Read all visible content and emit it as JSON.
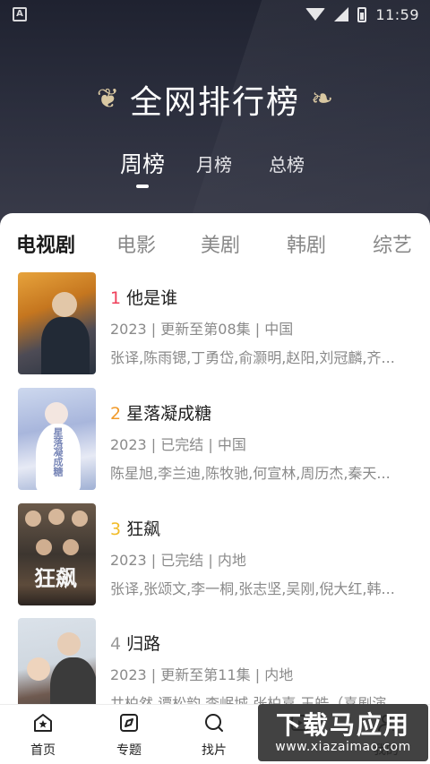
{
  "status_bar": {
    "time": "11:59"
  },
  "header": {
    "title": "全网排行榜",
    "rank_tabs": [
      {
        "label": "周榜",
        "active": true
      },
      {
        "label": "月榜",
        "active": false
      },
      {
        "label": "总榜",
        "active": false
      }
    ]
  },
  "categories": [
    {
      "label": "电视剧",
      "active": true
    },
    {
      "label": "电影",
      "active": false
    },
    {
      "label": "美剧",
      "active": false
    },
    {
      "label": "韩剧",
      "active": false
    },
    {
      "label": "综艺",
      "active": false
    }
  ],
  "items": [
    {
      "rank": "1",
      "title": "他是谁",
      "meta": "2023 | 更新至第08集 | 中国",
      "cast": "张译,陈雨锶,丁勇岱,俞灏明,赵阳,刘冠麟,齐..."
    },
    {
      "rank": "2",
      "title": "星落凝成糖",
      "meta": "2023 | 已完结 | 中国",
      "cast": "陈星旭,李兰迪,陈牧驰,何宣林,周历杰,秦天...",
      "poster_text": "星落凝成糖"
    },
    {
      "rank": "3",
      "title": "狂飙",
      "meta": "2023 | 已完结 | 内地",
      "cast": "张译,张颂文,李一桐,张志坚,吴刚,倪大红,韩...",
      "poster_text": "狂飙"
    },
    {
      "rank": "4",
      "title": "归路",
      "meta": "2023 | 更新至第11集 | 内地",
      "cast": "井柏然,谭松韵,李岷城,张柏嘉,王皓（喜剧演"
    }
  ],
  "bottom_nav": [
    {
      "label": "首页",
      "icon": "home-icon"
    },
    {
      "label": "专题",
      "icon": "compass-icon"
    },
    {
      "label": "找片",
      "icon": "search-icon"
    },
    {
      "label": "",
      "icon": "play-icon"
    },
    {
      "label": "我的",
      "icon": "user-icon"
    }
  ],
  "watermark": {
    "line1": "下载马应用",
    "line2": "www.xiazaimao.com"
  },
  "colors": {
    "rank1": "#ef3f5a",
    "rank2": "#f19a2a",
    "rank3": "#f2bb26",
    "rank4": "#9a9a9a",
    "header_bg": "#2b2e3d"
  }
}
